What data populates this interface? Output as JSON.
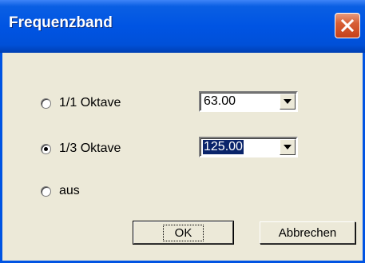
{
  "window": {
    "title": "Frequenzband"
  },
  "options": [
    {
      "label": "1/1 Oktave",
      "checked": false
    },
    {
      "label": "1/3 Oktave",
      "checked": true
    },
    {
      "label": "aus",
      "checked": false
    }
  ],
  "combos": [
    {
      "value": "63.00",
      "selected": false
    },
    {
      "value": "125.00",
      "selected": true
    }
  ],
  "buttons": {
    "ok": "OK",
    "cancel": "Abbrechen"
  },
  "colors": {
    "titlebar": "#0054e3",
    "close": "#d75f35",
    "face": "#ece9d8",
    "selection": "#0a246a"
  }
}
